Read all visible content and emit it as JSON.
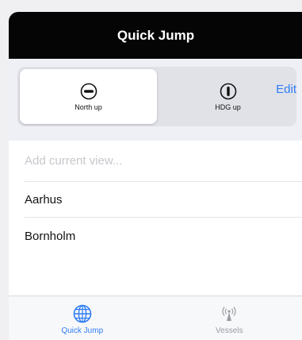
{
  "header": {
    "title": "Quick Jump"
  },
  "orientation": {
    "options": [
      {
        "label": "North up",
        "icon": "compass-north-icon",
        "selected": true
      },
      {
        "label": "HDG up",
        "icon": "compass-heading-icon",
        "selected": false
      }
    ]
  },
  "toolbar": {
    "edit_label": "Edit"
  },
  "list": {
    "add_placeholder": "Add current view...",
    "items": [
      "Aarhus",
      "Bornholm"
    ]
  },
  "tabbar": {
    "tabs": [
      {
        "label": "Quick Jump",
        "icon": "globe-icon",
        "active": true
      },
      {
        "label": "Vessels",
        "icon": "antenna-icon",
        "active": false
      }
    ]
  },
  "colors": {
    "accent": "#2f7cf6",
    "titlebar": "#050505"
  }
}
